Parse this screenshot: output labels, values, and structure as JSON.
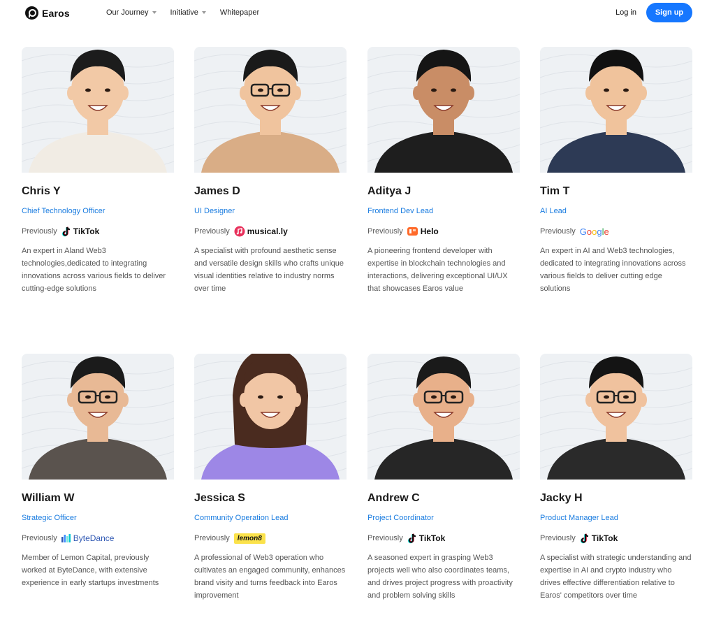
{
  "nav": {
    "brand": "Earos",
    "menu": [
      {
        "label": "Our Journey",
        "dropdown": true
      },
      {
        "label": "Initiative",
        "dropdown": true
      },
      {
        "label": "Whitepaper",
        "dropdown": false
      }
    ],
    "login": "Log in",
    "signup": "Sign up"
  },
  "team": [
    {
      "name": "Chris Y",
      "role": "Chief Technology Officer",
      "previously": "Previously",
      "company": "TikTok",
      "company_icon": "tiktok-icon",
      "bio": "An expert in Aland Web3 technologies,dedicated to integrating innovations across various fields to deliver cutting-edge solutions",
      "skin": "#f2c9a6",
      "hair": "#1c1c1c",
      "shirt": "#f1ece4",
      "glasses": false
    },
    {
      "name": "James D",
      "role": "UI Designer",
      "previously": "Previously",
      "company": "musical.ly",
      "company_icon": "musically-icon",
      "bio": "A specialist with profound aesthetic sense and versatile design skills who crafts unique visual identities relative to industry norms over time",
      "skin": "#f0c49e",
      "hair": "#1a1a1a",
      "shirt": "#d9ad86",
      "glasses": true
    },
    {
      "name": "Aditya J",
      "role": "Frontend Dev Lead",
      "previously": "Previously",
      "company": "Helo",
      "company_icon": "helo-icon",
      "bio": "A pioneering frontend developer with expertise in blockchain technologies and interactions, delivering exceptional UI/UX that showcases Earos value",
      "skin": "#c98d66",
      "hair": "#151515",
      "shirt": "#1e1e1e",
      "glasses": false
    },
    {
      "name": "Tim T",
      "role": "AI Lead",
      "previously": "Previously",
      "company": "Google",
      "company_icon": "google-icon",
      "bio": "An expert in AI and Web3 technologies, dedicated to integrating innovations across various fields to deliver cutting edge solutions",
      "skin": "#f0c39c",
      "hair": "#111111",
      "shirt": "#2d3a55",
      "glasses": false
    },
    {
      "name": "William W",
      "role": "Strategic Officer",
      "previously": "Previously",
      "company": "ByteDance",
      "company_icon": "bytedance-icon",
      "bio": "Member of Lemon Capital, previously worked at ByteDance, with extensive experience in early startups investments",
      "skin": "#e8b995",
      "hair": "#1b1b1b",
      "shirt": "#5a534e",
      "glasses": true
    },
    {
      "name": "Jessica S",
      "role": "Community Operation Lead",
      "previously": "Previously",
      "company": "lemon8",
      "company_icon": "lemon8-icon",
      "bio": "A professional of Web3 operation who cultivates an engaged community, enhances brand visity and turns feedback into Earos improvement",
      "skin": "#f1c6a5",
      "hair": "#4a2b1f",
      "shirt": "#9d87e6",
      "glasses": false
    },
    {
      "name": "Andrew C",
      "role": "Project Coordinator",
      "previously": "Previously",
      "company": "TikTok",
      "company_icon": "tiktok-icon",
      "bio": "A seasoned expert in grasping Web3 projects well who also coordinates teams, and drives project progress with proactivity and problem solving skills",
      "skin": "#e8b08a",
      "hair": "#1a1a1a",
      "shirt": "#262626",
      "glasses": true
    },
    {
      "name": "Jacky H",
      "role": "Product Manager Lead",
      "previously": "Previously",
      "company": "TikTok",
      "company_icon": "tiktok-icon",
      "bio": "A specialist with strategic understanding and expertise in AI and crypto industry who drives effective differentiation relative to Earos' competitors over time",
      "skin": "#f0c29e",
      "hair": "#141414",
      "shirt": "#2a2a2a",
      "glasses": true
    }
  ],
  "colors": {
    "accent": "#1677ff",
    "role_text": "#1a7ce0"
  }
}
